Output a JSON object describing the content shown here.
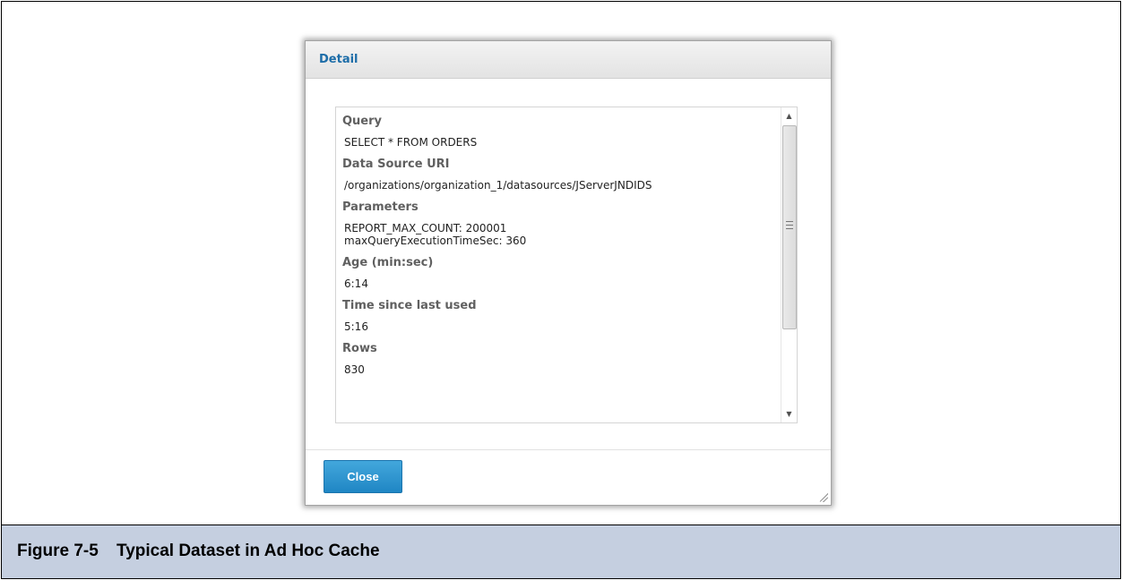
{
  "dialog": {
    "title": "Detail",
    "close_label": "Close"
  },
  "detail": {
    "fields": [
      {
        "label": "Query",
        "value": "SELECT * FROM ORDERS"
      },
      {
        "label": "Data Source URI",
        "value": "/organizations/organization_1/datasources/JServerJNDIDS"
      },
      {
        "label": "Parameters",
        "values": [
          "REPORT_MAX_COUNT: 200001",
          "maxQueryExecutionTimeSec: 360"
        ]
      },
      {
        "label": "Age (min:sec)",
        "value": "6:14"
      },
      {
        "label": "Time since last used",
        "value": "5:16"
      },
      {
        "label": "Rows",
        "value": "830"
      }
    ]
  },
  "caption": {
    "number": "Figure 7-5",
    "title": "Typical Dataset in Ad Hoc Cache"
  },
  "colors": {
    "title_blue": "#1d6da8",
    "button_blue": "#2b93d0",
    "caption_bg": "#c5cfe0"
  },
  "icons": {
    "scroll_up": "scroll-up-arrow-icon",
    "scroll_down": "scroll-down-arrow-icon",
    "resize": "resize-grip-icon"
  }
}
